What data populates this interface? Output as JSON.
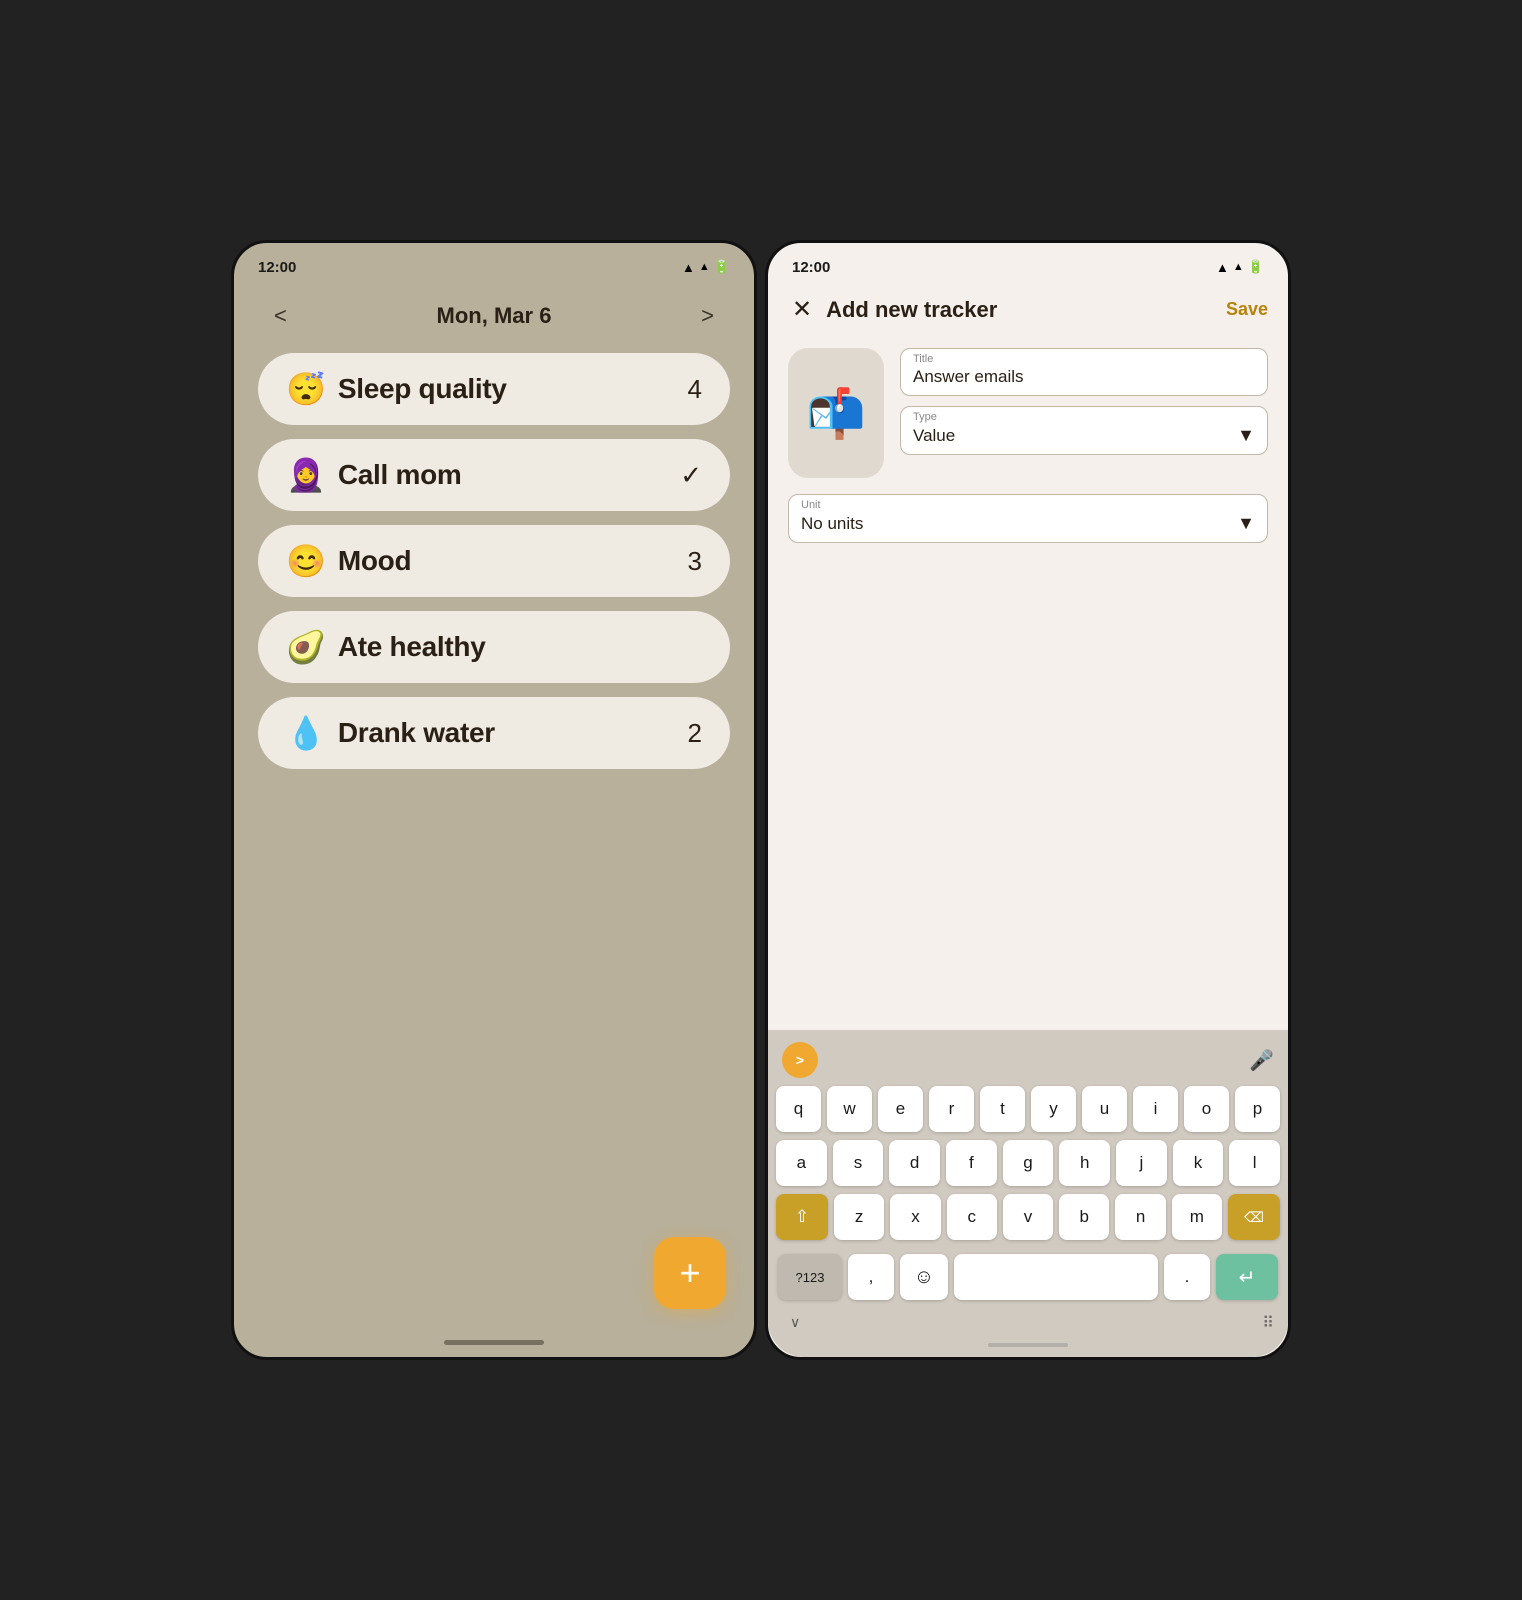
{
  "left_phone": {
    "status_time": "12:00",
    "date": "Mon, Mar 6",
    "nav_prev": "<",
    "nav_next": ">",
    "trackers": [
      {
        "emoji": "😴",
        "name": "Sleep quality",
        "value": "4",
        "type": "number"
      },
      {
        "emoji": "🧕",
        "name": "Call mom",
        "value": "✓",
        "type": "check"
      },
      {
        "emoji": "😊",
        "name": "Mood",
        "value": "3",
        "type": "number"
      },
      {
        "emoji": "🥑",
        "name": "Ate healthy",
        "value": "",
        "type": "boolean"
      },
      {
        "emoji": "💧",
        "name": "Drank water",
        "value": "2",
        "type": "number"
      }
    ],
    "fab_label": "+"
  },
  "right_phone": {
    "status_time": "12:00",
    "header_title": "Add new tracker",
    "close_icon": "✕",
    "save_label": "Save",
    "emoji_icon": "📬",
    "title_label": "Title",
    "title_value": "Answer emails",
    "type_label": "Type",
    "type_value": "Value",
    "unit_label": "Unit",
    "unit_value": "No units",
    "keyboard": {
      "toolbar_chevron": ">",
      "mic_icon": "🎤",
      "rows": [
        [
          "q",
          "w",
          "e",
          "r",
          "t",
          "y",
          "u",
          "i",
          "o",
          "p"
        ],
        [
          "a",
          "s",
          "d",
          "f",
          "g",
          "h",
          "j",
          "k",
          "l"
        ],
        [
          "⇧",
          "z",
          "x",
          "c",
          "v",
          "b",
          "n",
          "m",
          "⌫"
        ],
        [
          "?123",
          ",",
          "😊",
          "",
          ".",
          "↵"
        ]
      ]
    }
  }
}
